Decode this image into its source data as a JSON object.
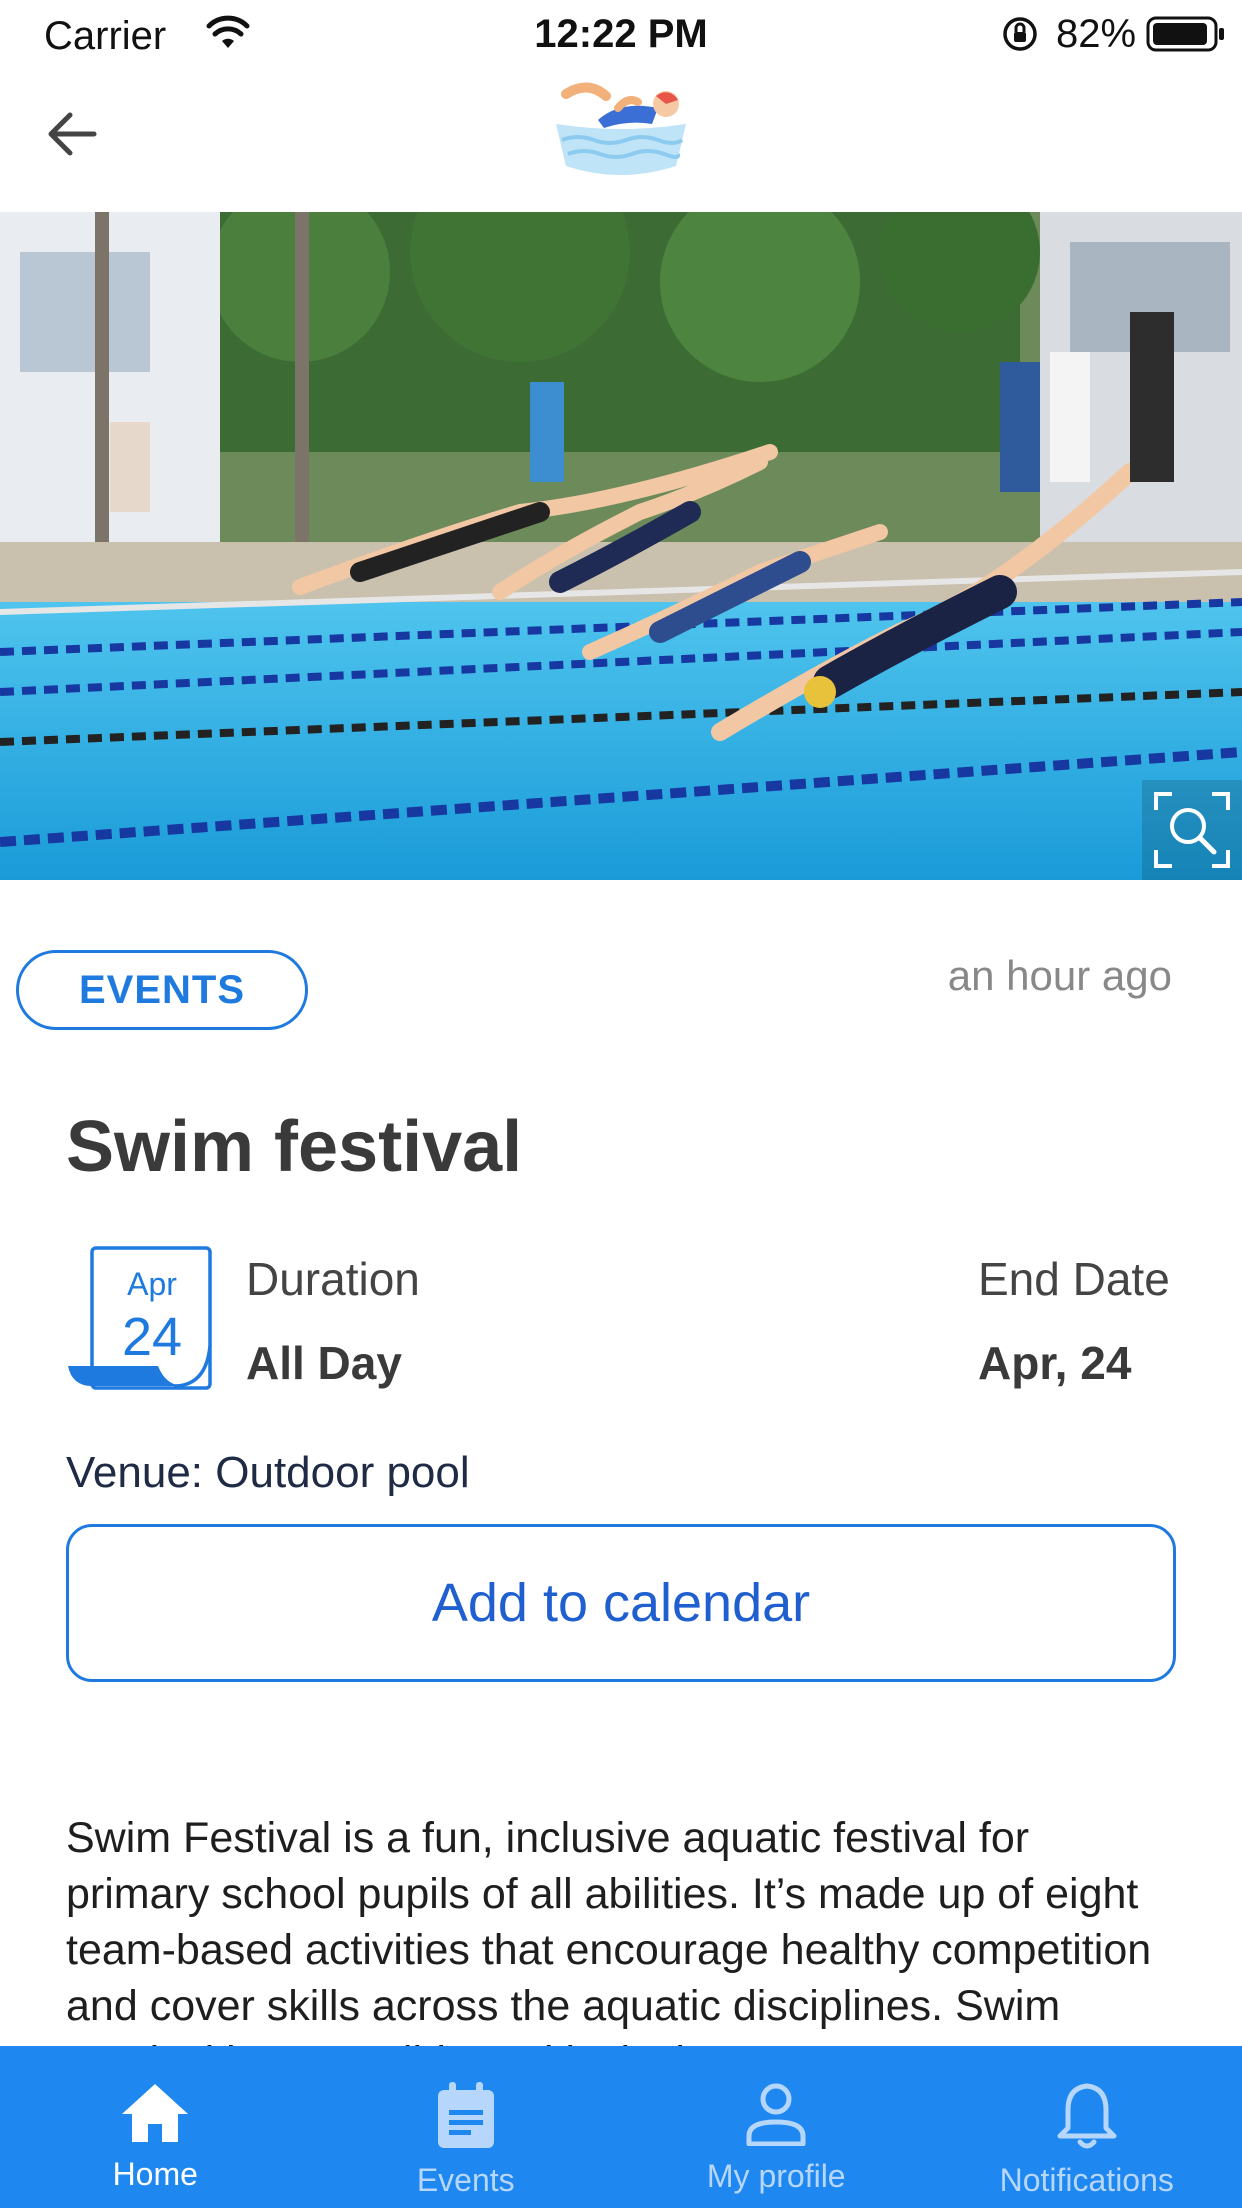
{
  "status_bar": {
    "carrier": "Carrier",
    "time": "12:22 PM",
    "battery": "82%"
  },
  "header": {
    "back_icon": "arrow-left-icon",
    "logo": "swimmer-logo"
  },
  "hero": {
    "alt": "Swimmers diving into outdoor pool",
    "zoom_icon": "search-icon"
  },
  "post": {
    "category": "EVENTS",
    "time_ago": "an hour ago",
    "title": "Swim festival",
    "calendar": {
      "month": "Apr",
      "day": "24"
    },
    "duration_label": "Duration",
    "duration_value": "All Day",
    "end_date_label": "End Date",
    "end_date_value": "Apr, 24",
    "venue": "Venue: Outdoor pool",
    "add_to_calendar": "Add to calendar",
    "description": "Swim Festival is a fun, inclusive aquatic festival for primary school pupils of all abilities. It’s made up of eight team-based activities that encourage healthy competition and cover skills across the aquatic disciplines. Swim Festival is accessible and inclusive"
  },
  "nav": [
    {
      "label": "Home",
      "icon": "home-icon",
      "active": true
    },
    {
      "label": "Events",
      "icon": "calendar-icon",
      "active": false
    },
    {
      "label": "My profile",
      "icon": "user-icon",
      "active": false
    },
    {
      "label": "Notifications",
      "icon": "bell-icon",
      "active": false
    }
  ],
  "colors": {
    "accent": "#1f7ae0",
    "nav_bg": "#1e88f0",
    "title": "#3a3a3a"
  }
}
